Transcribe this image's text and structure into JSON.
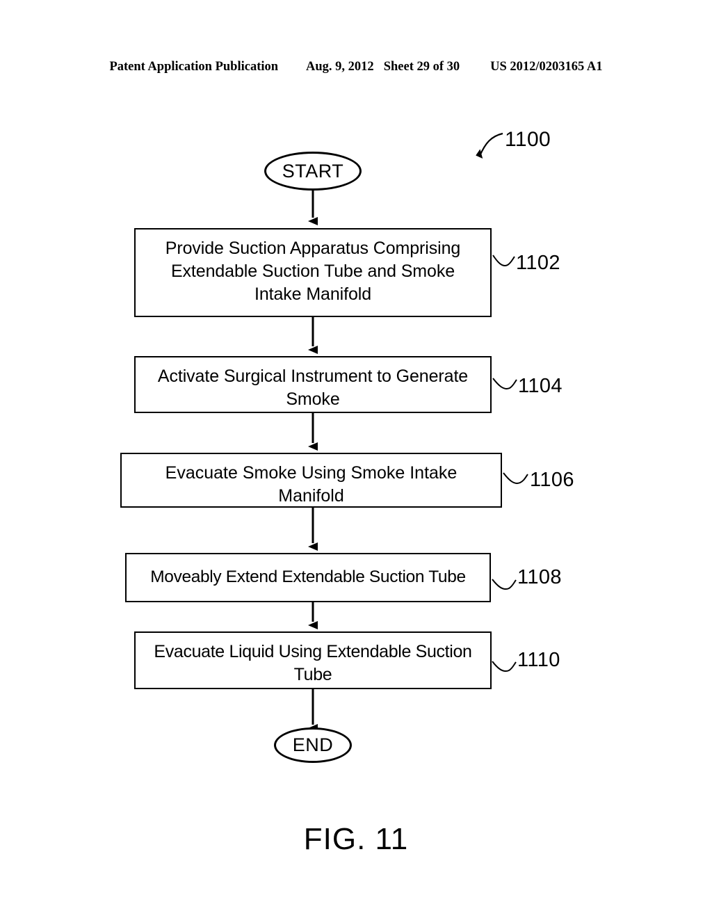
{
  "header": {
    "publication": "Patent Application Publication",
    "date": "Aug. 9, 2012",
    "sheet": "Sheet 29 of 30",
    "number": "US 2012/0203165 A1"
  },
  "figure": {
    "caption": "FIG. 11",
    "diagram_ref": "1100"
  },
  "flowchart": {
    "start_label": "START",
    "end_label": "END",
    "steps": [
      {
        "ref": "1102",
        "text": "Provide Suction Apparatus Comprising\nExtendable Suction Tube and Smoke\nIntake Manifold"
      },
      {
        "ref": "1104",
        "text": "Activate Surgical Instrument to Generate\nSmoke"
      },
      {
        "ref": "1106",
        "text": "Evacuate Smoke Using Smoke Intake\nManifold"
      },
      {
        "ref": "1108",
        "text": "Moveably Extend Extendable Suction Tube"
      },
      {
        "ref": "1110",
        "text": "Evacuate Liquid Using Extendable Suction\nTube"
      }
    ]
  },
  "colors": {
    "ink": "#000000",
    "paper": "#ffffff"
  }
}
